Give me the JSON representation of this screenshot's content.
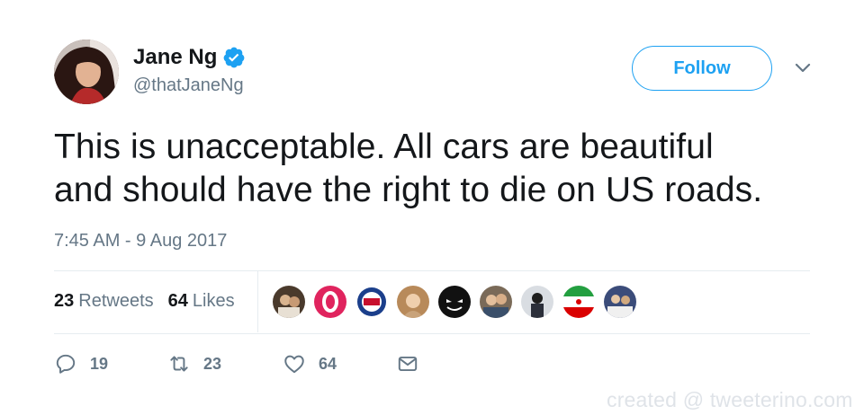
{
  "author": {
    "name": "Jane Ng",
    "handle": "@thatJaneNg"
  },
  "header": {
    "follow_label": "Follow",
    "verified_icon": "verified-badge-icon",
    "menu_icon": "chevron-down-icon"
  },
  "tweet": {
    "line1": "This is unacceptable. All cars are beautiful",
    "line2": "and should have the right to die on US roads.",
    "timestamp": "7:45 AM - 9 Aug 2017"
  },
  "stats": {
    "retweets_count": "23",
    "retweets_label": "Retweets",
    "likes_count": "64",
    "likes_label": "Likes"
  },
  "actions": {
    "replies": "19",
    "retweets": "23",
    "likes": "64"
  },
  "colors": {
    "accent": "#1da1f2",
    "text": "#14171a",
    "muted": "#657786"
  },
  "watermark": "created @ tweeterino.com"
}
